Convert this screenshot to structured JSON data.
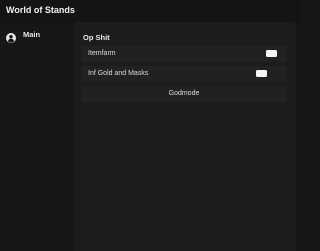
{
  "window": {
    "title": "World of Stands"
  },
  "sidebar": {
    "tabs": [
      {
        "label": "Main",
        "icon": "user-circle-icon",
        "selected": true
      }
    ]
  },
  "main": {
    "section_title": "Op Shit",
    "toggles": [
      {
        "label": "Itemfarm",
        "state": "on"
      },
      {
        "label": "Inf Gold and Masks",
        "state": "on"
      }
    ],
    "buttons": [
      {
        "label": "Godmode"
      }
    ]
  },
  "colors": {
    "background": "#171717",
    "panel": "#1c1c1c",
    "row": "#212121",
    "text": "#e6e6e6",
    "toggle": "#f4f4f4"
  }
}
